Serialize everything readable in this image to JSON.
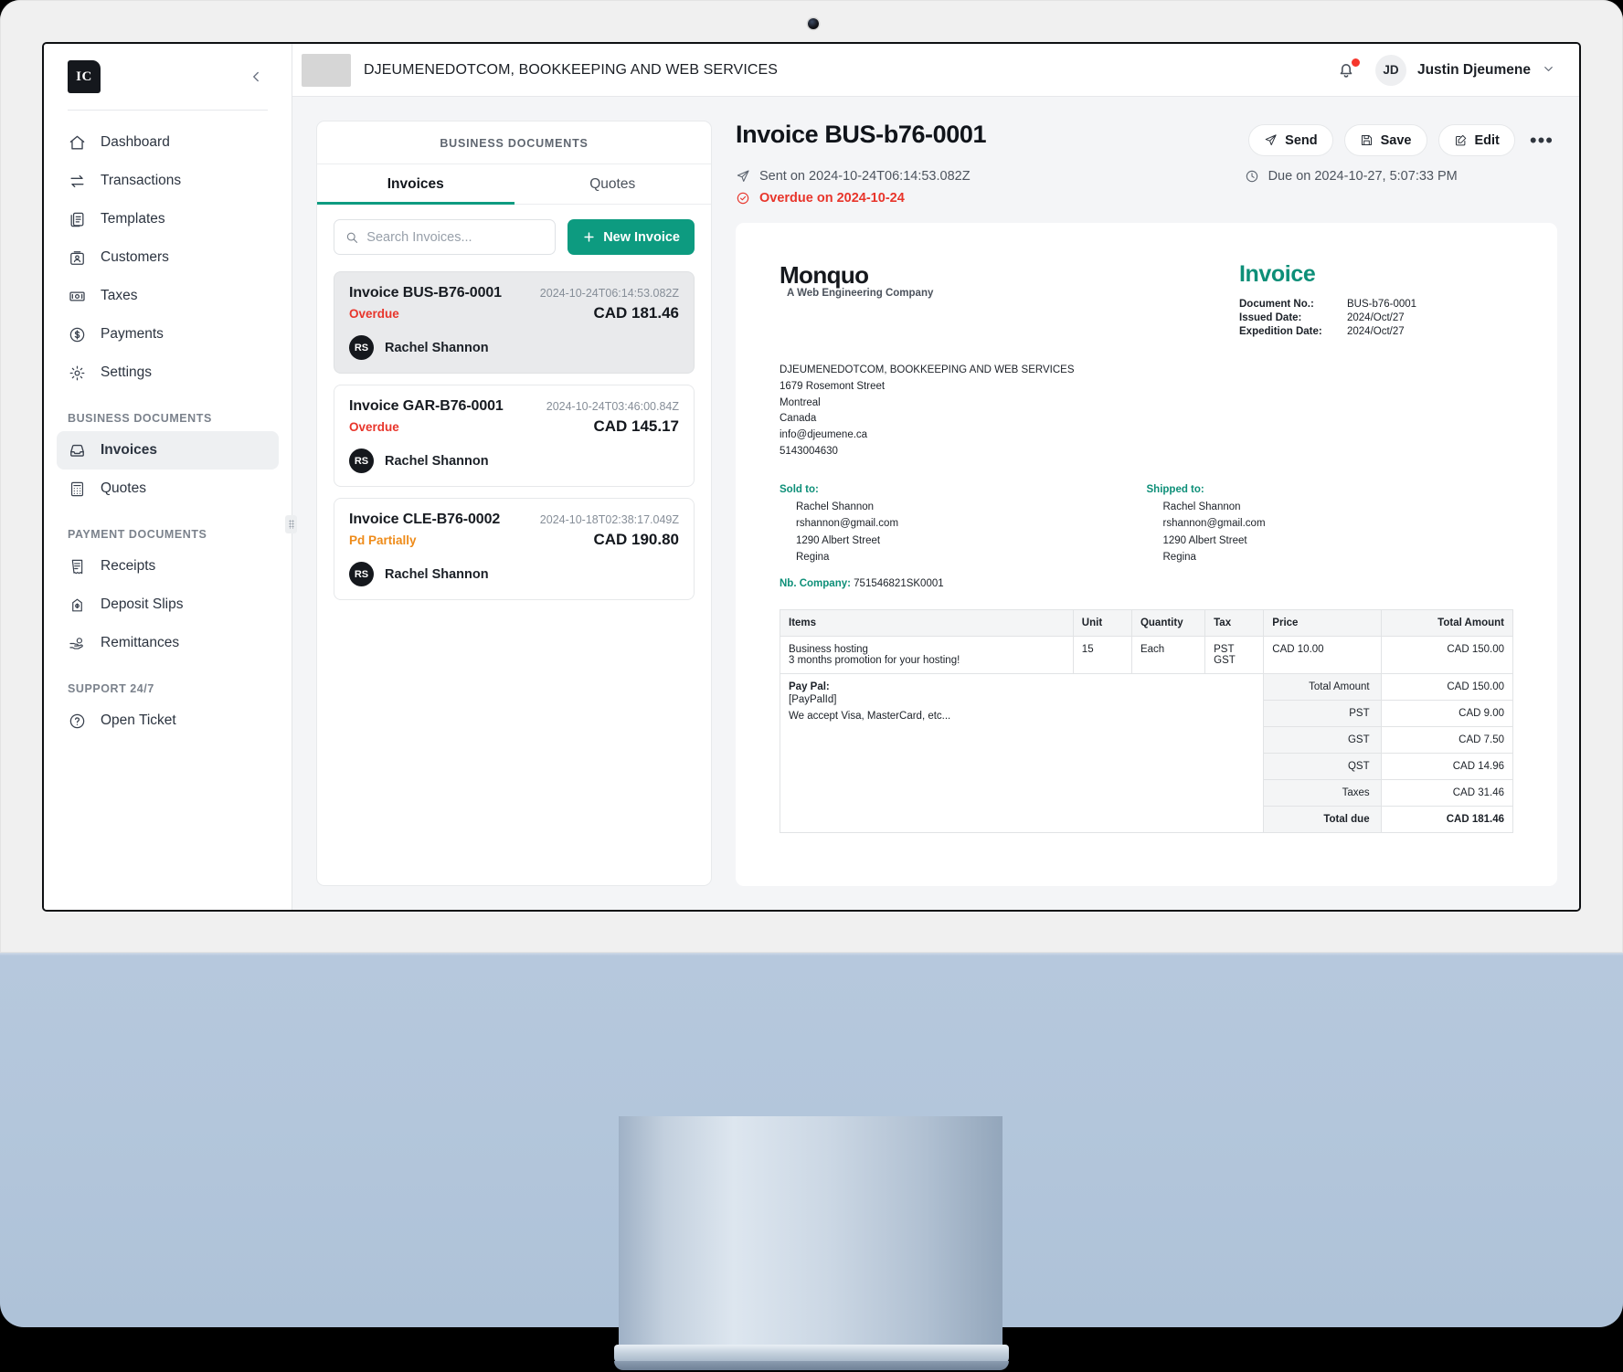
{
  "app": {
    "logo_text": "IC",
    "collapse_icon": "chevron-left-icon"
  },
  "sidebar": {
    "items": [
      {
        "label": "Dashboard",
        "icon": "home-icon"
      },
      {
        "label": "Transactions",
        "icon": "transfer-icon"
      },
      {
        "label": "Templates",
        "icon": "documents-icon"
      },
      {
        "label": "Customers",
        "icon": "contact-card-icon"
      },
      {
        "label": "Taxes",
        "icon": "banknote-icon"
      },
      {
        "label": "Payments",
        "icon": "dollar-circle-icon"
      },
      {
        "label": "Settings",
        "icon": "gear-icon"
      }
    ],
    "section_business": "BUSINESS DOCUMENTS",
    "business_items": [
      {
        "label": "Invoices",
        "icon": "inbox-icon",
        "active": true
      },
      {
        "label": "Quotes",
        "icon": "calculator-icon",
        "active": false
      }
    ],
    "section_payment": "PAYMENT DOCUMENTS",
    "payment_items": [
      {
        "label": "Receipts",
        "icon": "receipt-icon"
      },
      {
        "label": "Deposit Slips",
        "icon": "deposit-icon"
      },
      {
        "label": "Remittances",
        "icon": "hand-coin-icon"
      }
    ],
    "section_support": "SUPPORT 24/7",
    "support_items": [
      {
        "label": "Open Ticket",
        "icon": "question-circle-icon"
      }
    ]
  },
  "topbar": {
    "company": "DJEUMENEDOTCOM, BOOKKEEPING AND WEB SERVICES",
    "notification_icon": "bell-icon",
    "has_notification": true,
    "avatar_initials": "JD",
    "user_name": "Justin Djeumene",
    "caret_icon": "chevron-down-icon"
  },
  "docs_panel": {
    "title": "BUSINESS DOCUMENTS",
    "tabs": [
      {
        "label": "Invoices",
        "active": true
      },
      {
        "label": "Quotes",
        "active": false
      }
    ],
    "search_placeholder": "Search Invoices...",
    "search_value": "",
    "new_button": "New Invoice",
    "cards": [
      {
        "title": "Invoice BUS-B76-0001",
        "date": "2024-10-24T06:14:53.082Z",
        "status": "Overdue",
        "status_color": "#e8352b",
        "amount": "CAD 181.46",
        "customer": "Rachel Shannon",
        "initials": "RS",
        "selected": true
      },
      {
        "title": "Invoice GAR-B76-0001",
        "date": "2024-10-24T03:46:00.84Z",
        "status": "Overdue",
        "status_color": "#e8352b",
        "amount": "CAD 145.17",
        "customer": "Rachel Shannon",
        "initials": "RS",
        "selected": false
      },
      {
        "title": "Invoice CLE-B76-0002",
        "date": "2024-10-18T02:38:17.049Z",
        "status": "Pd Partially",
        "status_color": "#ee8b19",
        "amount": "CAD 190.80",
        "customer": "Rachel Shannon",
        "initials": "RS",
        "selected": false
      }
    ]
  },
  "detail": {
    "title": "Invoice BUS-b76-0001",
    "actions": [
      {
        "label": "Send",
        "icon": "send-icon"
      },
      {
        "label": "Save",
        "icon": "floppy-disk-icon"
      },
      {
        "label": "Edit",
        "icon": "pencil-square-icon"
      }
    ],
    "more_icon": "ellipsis-icon",
    "sent_text": "Sent on 2024-10-24T06:14:53.082Z",
    "due_text": "Due on 2024-10-27, 5:07:33 PM",
    "overdue_text": "Overdue on 2024-10-24"
  },
  "invoice": {
    "logo": "Monquo",
    "logo_tagline": "A Web Engineering Company",
    "heading": "Invoice",
    "meta": [
      {
        "key": "Document No.:",
        "value": "BUS-b76-0001"
      },
      {
        "key": "Issued Date:",
        "value": "2024/Oct/27"
      },
      {
        "key": "Expedition Date:",
        "value": "2024/Oct/27"
      }
    ],
    "from": [
      "DJEUMENEDOTCOM, BOOKKEEPING AND WEB SERVICES",
      "1679 Rosemont Street",
      "Montreal",
      "Canada",
      "info@djeumene.ca",
      "5143004630"
    ],
    "sold_to_label": "Sold to:",
    "sold_to": [
      "Rachel Shannon",
      "rshannon@gmail.com",
      "1290 Albert Street",
      "Regina"
    ],
    "shipped_to_label": "Shipped to:",
    "shipped_to": [
      "Rachel Shannon",
      "rshannon@gmail.com",
      "1290 Albert Street",
      "Regina"
    ],
    "company_no_label": "Nb. Company:",
    "company_no": "751546821SK0001",
    "table": {
      "headers": [
        "Items",
        "Unit",
        "Quantity",
        "Tax",
        "Price",
        "Total Amount"
      ],
      "rows": [
        {
          "item_name": "Business hosting",
          "item_desc": "3 months promotion for your hosting!",
          "unit": "15",
          "quantity": "Each",
          "tax": [
            "PST",
            "GST"
          ],
          "price": "CAD 10.00",
          "total": "CAD 150.00"
        }
      ]
    },
    "paypal_label": "Pay Pal:",
    "paypal_id": "[PayPalId]",
    "paypal_note": "We accept Visa, MasterCard, etc...",
    "totals": [
      {
        "label": "Total Amount",
        "value": "CAD 150.00",
        "strong": false
      },
      {
        "label": "PST",
        "value": "CAD 9.00",
        "strong": false
      },
      {
        "label": "GST",
        "value": "CAD 7.50",
        "strong": false
      },
      {
        "label": "QST",
        "value": "CAD 14.96",
        "strong": false
      },
      {
        "label": "Taxes",
        "value": "CAD 31.46",
        "strong": false
      },
      {
        "label": "Total due",
        "value": "CAD 181.46",
        "strong": true
      }
    ]
  },
  "colors": {
    "accent_teal": "#0d9b80",
    "overdue_red": "#e8352b",
    "partial_orange": "#ee8b19",
    "notification_red": "#f6362c"
  }
}
